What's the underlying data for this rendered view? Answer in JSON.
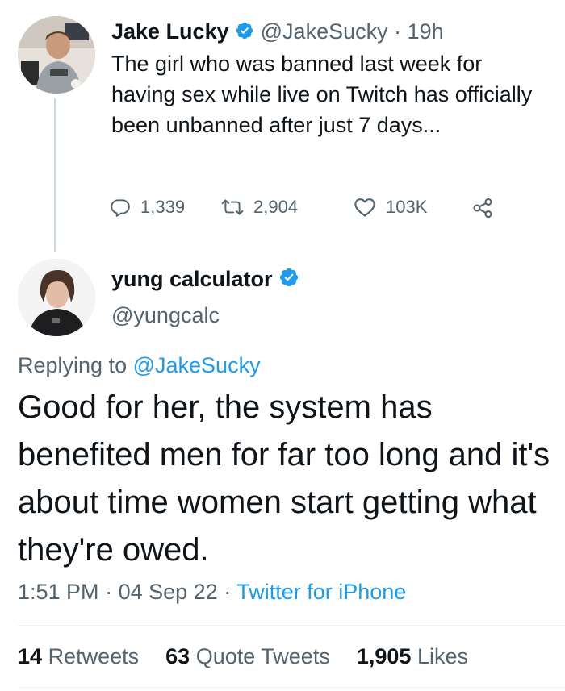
{
  "parent_tweet": {
    "author_name": "Jake Lucky",
    "handle": "@JakeSucky",
    "separator": "·",
    "time_ago": "19h",
    "text": "The girl who was banned last week for having sex while live on Twitch has officially been unbanned after just 7 days...",
    "replies": "1,339",
    "retweets": "2,904",
    "likes": "103K"
  },
  "reply_tweet": {
    "author_name": "yung calculator",
    "handle": "@yungcalc",
    "replying_prefix": "Replying to",
    "replying_to": "@JakeSucky",
    "text": "Good for her, the system has benefited men for far too long and it's about time women start getting what they're owed.",
    "time": "1:51 PM",
    "date": "04 Sep 22",
    "source": "Twitter for iPhone",
    "dot": "·",
    "retweets_count": "14",
    "retweets_label": "Retweets",
    "quotes_count": "63",
    "quotes_label": "Quote Tweets",
    "likes_count": "1,905",
    "likes_label": "Likes"
  },
  "icons": {
    "verified": "verified-badge-icon",
    "reply": "reply-bubble-icon",
    "retweet": "retweet-icon",
    "like": "heart-icon",
    "share": "share-icon"
  },
  "colors": {
    "accent": "#1d9bf0",
    "text": "#0f1419",
    "muted": "#536471",
    "thread_line": "#cfd9de"
  }
}
